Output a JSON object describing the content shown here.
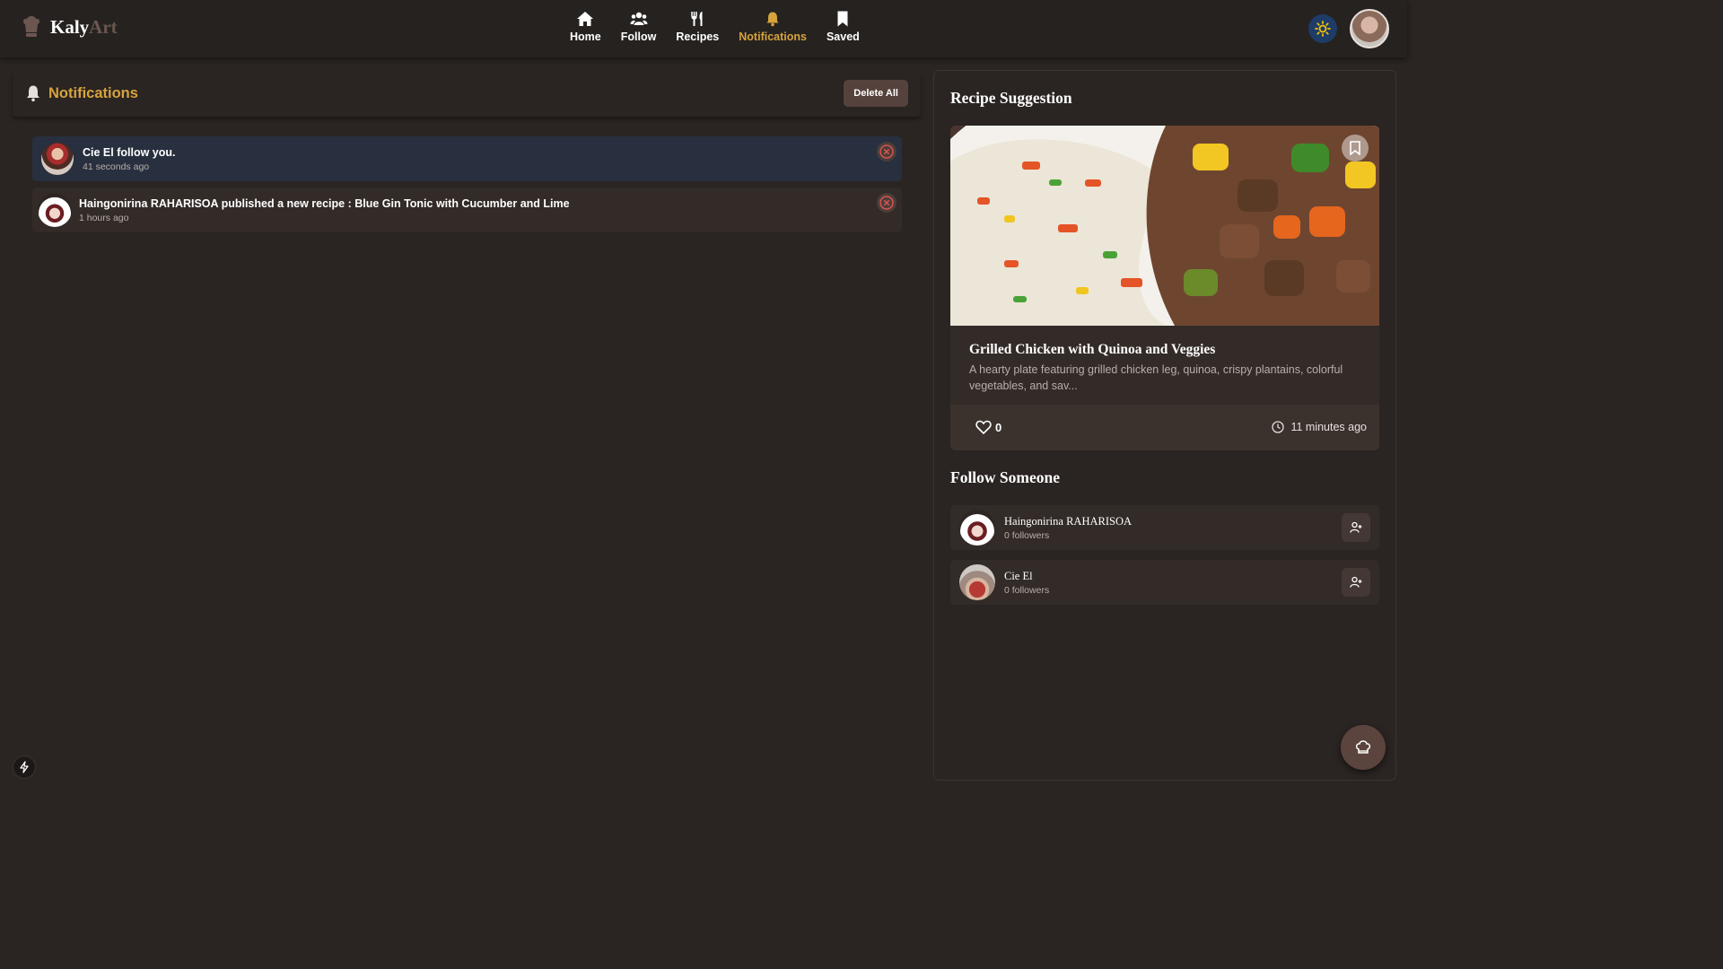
{
  "app": {
    "name_part1": "Kaly",
    "name_part2": "Art"
  },
  "nav": {
    "items": [
      {
        "label": "Home",
        "icon": "home-icon",
        "active": false
      },
      {
        "label": "Follow",
        "icon": "users-icon",
        "active": false
      },
      {
        "label": "Recipes",
        "icon": "utensils-icon",
        "active": false
      },
      {
        "label": "Notifications",
        "icon": "bell-icon",
        "active": true
      },
      {
        "label": "Saved",
        "icon": "bookmark-icon",
        "active": false
      }
    ]
  },
  "notifications": {
    "title": "Notifications",
    "delete_all_label": "Delete All",
    "items": [
      {
        "message": "Cie El follow you.",
        "time": "41 seconds ago",
        "unread": true
      },
      {
        "message": "Haingonirina RAHARISOA published a new recipe : Blue Gin Tonic with Cucumber and Lime",
        "time": "1 hours ago",
        "unread": false
      }
    ]
  },
  "suggestion": {
    "title": "Recipe Suggestion",
    "recipe": {
      "title": "Grilled Chicken with Quinoa and Veggies",
      "description": "A hearty plate featuring grilled chicken leg, quinoa, crispy plantains, colorful vegetables, and sav...",
      "likes": "0",
      "time": "11 minutes ago"
    }
  },
  "follow": {
    "title": "Follow Someone",
    "people": [
      {
        "name": "Haingonirina RAHARISOA",
        "followers": "0 followers"
      },
      {
        "name": "Cie El",
        "followers": "0 followers"
      }
    ]
  },
  "colors": {
    "accent": "#d6a33d",
    "background": "#2a2422",
    "card": "#332b28",
    "unread": "#28303f",
    "close": "#d9534f"
  }
}
